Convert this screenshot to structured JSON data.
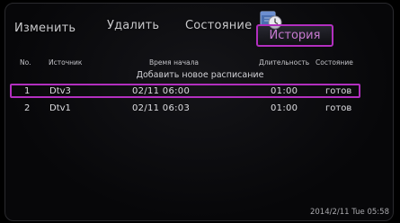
{
  "tabs": {
    "edit": "Изменить",
    "delete": "Удалить",
    "status": "Состояние",
    "history": "История"
  },
  "icons": {
    "history": "calendar-clock-icon"
  },
  "table": {
    "headers": {
      "no": "No.",
      "source": "Источник",
      "start": "Время начала",
      "duration": "Длительность",
      "state": "Состояние"
    },
    "add_new": "Добавить новое расписание",
    "rows": [
      {
        "no": "1",
        "source": "Dtv3",
        "start": "02/11 06:00",
        "duration": "01:00",
        "state": "готов"
      },
      {
        "no": "2",
        "source": "Dtv1",
        "start": "02/11 06:03",
        "duration": "01:00",
        "state": "готов"
      }
    ]
  },
  "clock": "2014/2/11 Tue 05:58",
  "colors": {
    "highlight": "#b22fbf",
    "text": "#dfdfe3",
    "background": "#070709"
  }
}
